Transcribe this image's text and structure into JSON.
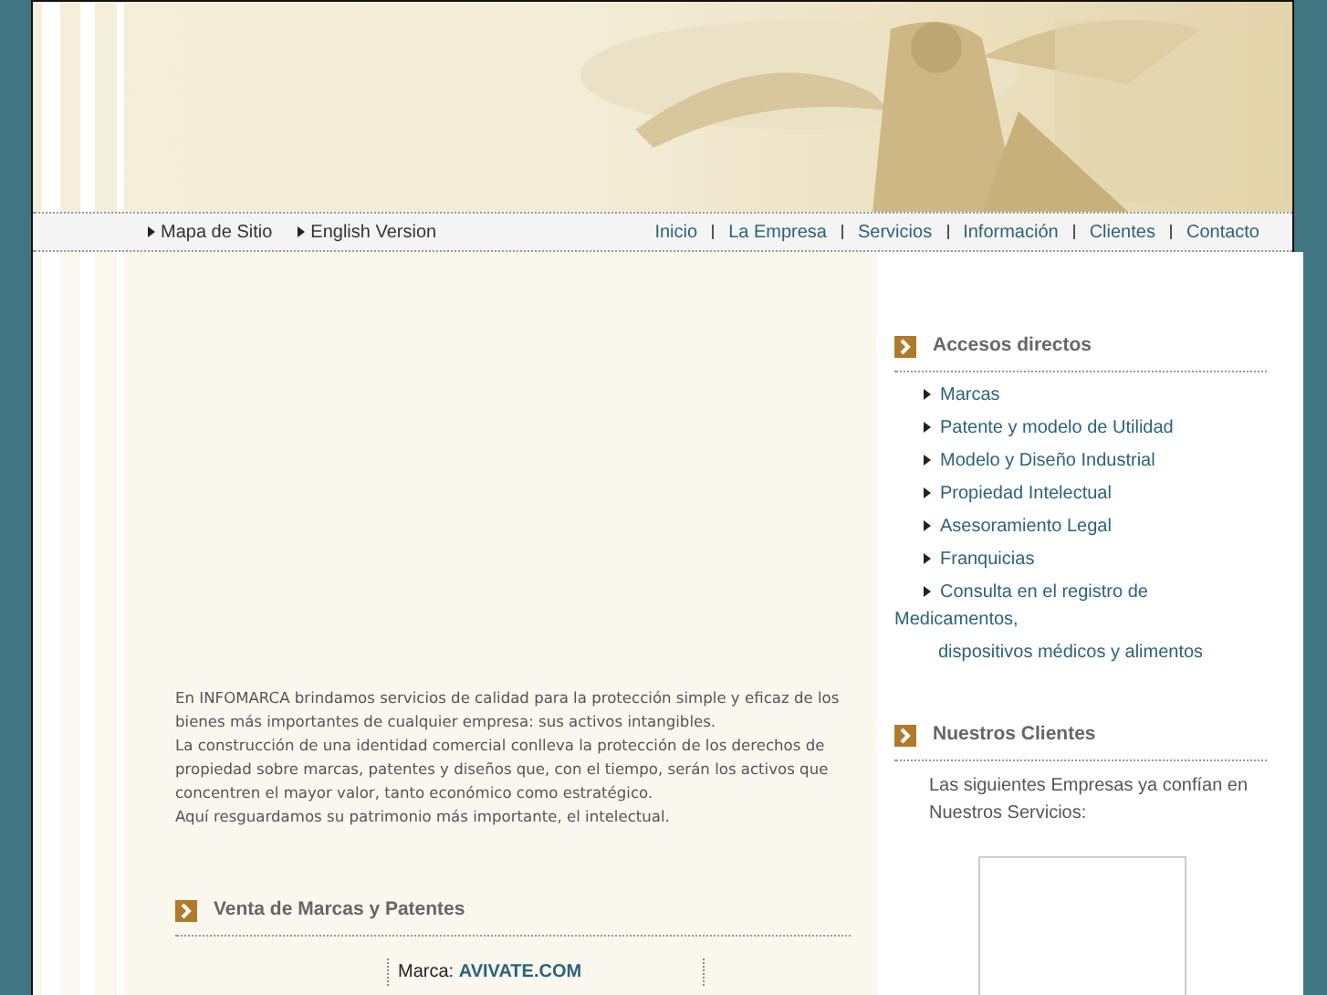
{
  "top_links": [
    {
      "label": "Mapa de Sitio"
    },
    {
      "label": "English Version"
    }
  ],
  "nav": [
    {
      "label": "Inicio"
    },
    {
      "label": "La Empresa"
    },
    {
      "label": "Servicios"
    },
    {
      "label": "Información"
    },
    {
      "label": "Clientes"
    },
    {
      "label": "Contacto"
    }
  ],
  "intro": [
    "En INFOMARCA brindamos servicios de calidad para la protección simple y eficaz de los bienes más importantes de cualquier empresa: sus activos intangibles.",
    "La construcción de una identidad comercial conlleva la protección de los derechos de propiedad sobre marcas, patentes y diseños que, con el tiempo, serán los activos que concentren el mayor valor, tanto económico como estratégico.",
    "Aquí resguardamos su patrimonio más importante, el intelectual."
  ],
  "sale": {
    "title": "Venta de Marcas y Patentes",
    "label": "Marca:",
    "value": "AVIVATE.COM"
  },
  "shortcuts": {
    "title": "Accesos directos",
    "items": [
      {
        "label": "Marcas"
      },
      {
        "label": "Patente y modelo de Utilidad"
      },
      {
        "label": "Modelo y Diseño Industrial"
      },
      {
        "label": "Propiedad Intelectual"
      },
      {
        "label": "Asesoramiento Legal"
      },
      {
        "label": "Franquicias"
      },
      {
        "label": "Consulta en el registro de"
      }
    ],
    "trailing": [
      "Medicamentos,",
      "dispositivos médicos y alimentos"
    ]
  },
  "clients": {
    "title": "Nuestros Clientes",
    "text": "Las siguientes Empresas ya confían en Nuestros Servicios:"
  }
}
